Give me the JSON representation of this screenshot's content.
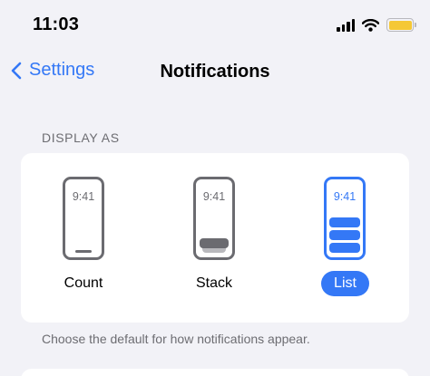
{
  "status_bar": {
    "time": "11:03",
    "signal_icon": "cellular-signal-icon",
    "wifi_icon": "wifi-icon",
    "battery_icon": "battery-icon",
    "battery_color": "#f5c836"
  },
  "nav": {
    "back_label": "Settings",
    "back_icon": "chevron-left-icon",
    "title": "Notifications"
  },
  "display_as": {
    "header": "DISPLAY AS",
    "options": [
      {
        "label": "Count",
        "preview_time": "9:41",
        "selected": false
      },
      {
        "label": "Stack",
        "preview_time": "9:41",
        "selected": false
      },
      {
        "label": "List",
        "preview_time": "9:41",
        "selected": true
      }
    ],
    "footer": "Choose the default for how notifications appear."
  },
  "colors": {
    "accent": "#3478f6",
    "background": "#f2f2f7",
    "card": "#ffffff",
    "secondary_text": "#6d6d72"
  }
}
